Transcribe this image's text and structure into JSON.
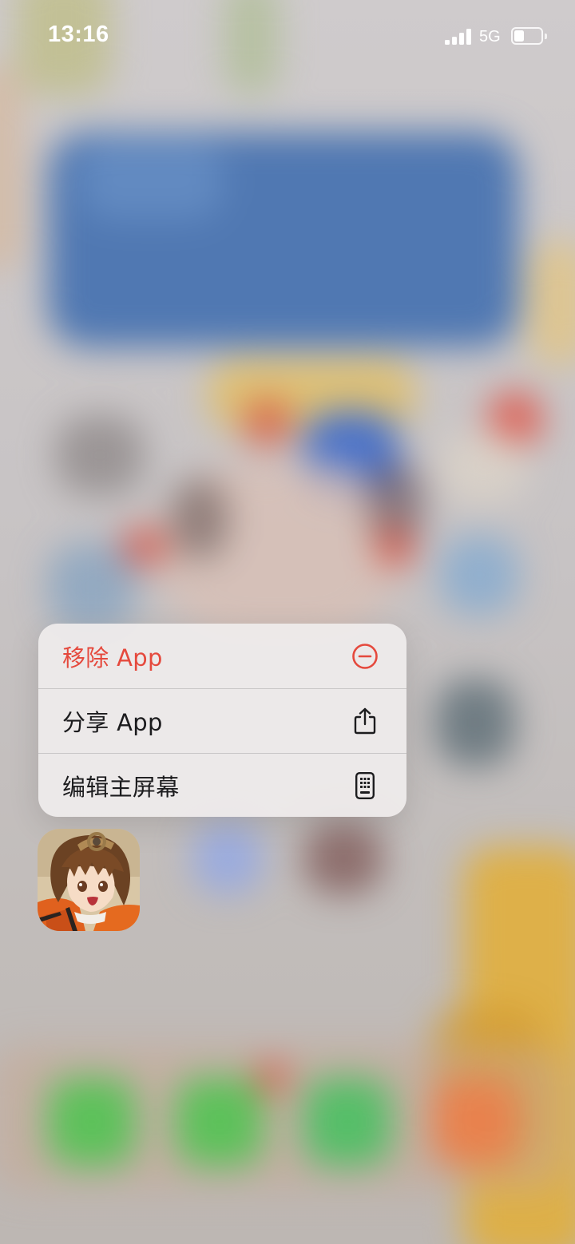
{
  "status_bar": {
    "time": "13:16",
    "network": "5G",
    "signal_bars": 4,
    "battery_level_fraction": 0.3,
    "icons": [
      "signal-icon",
      "battery-icon"
    ]
  },
  "context_menu": {
    "items": [
      {
        "label": "移除 App",
        "icon": "remove-circle-icon",
        "color": "#e5493d",
        "destructive": true
      },
      {
        "label": "分享 App",
        "icon": "share-icon",
        "color": "#1c1c1e",
        "destructive": false
      },
      {
        "label": "编辑主屏幕",
        "icon": "phone-grid-icon",
        "color": "#1c1c1e",
        "destructive": false
      }
    ]
  },
  "focused_app": {
    "icon": "anime-game-app-icon"
  },
  "colors": {
    "destructive": "#e5493d",
    "menu_background": "#efecec",
    "text_primary": "#1c1c1e"
  }
}
